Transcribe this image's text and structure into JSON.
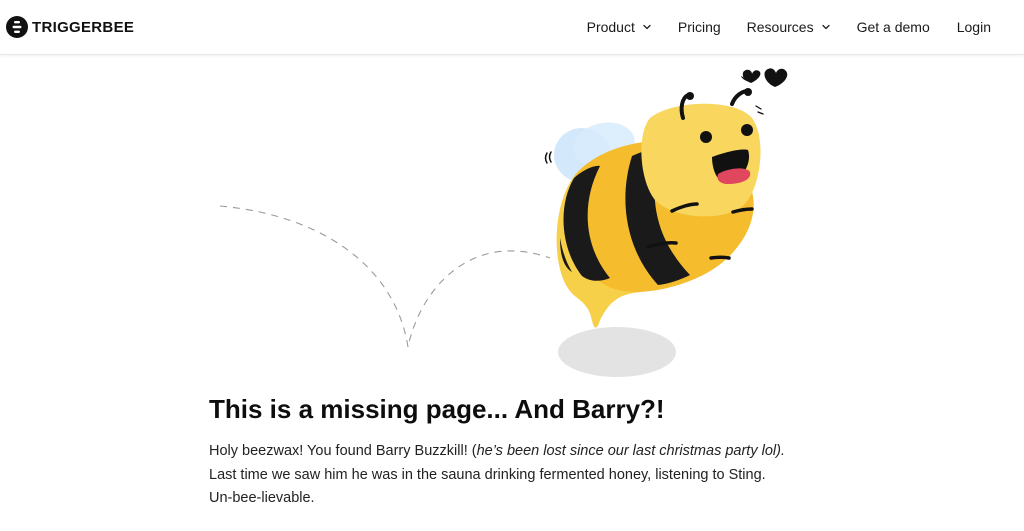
{
  "header": {
    "brand": "TRIGGERBEE",
    "nav": [
      {
        "label": "Product",
        "has_dropdown": true
      },
      {
        "label": "Pricing",
        "has_dropdown": false
      },
      {
        "label": "Resources",
        "has_dropdown": true
      },
      {
        "label": "Get a demo",
        "has_dropdown": false
      },
      {
        "label": "Login",
        "has_dropdown": false
      }
    ]
  },
  "main": {
    "title": "This is a missing page... And Barry?!",
    "body_intro": "Holy beezwax! You found Barry Buzzkill! (",
    "body_italic": "he’s been lost since our last christmas party lol).",
    "body_rest": " Last time we saw him he was in the sauna drinking fermented honey, listening to Sting. Un-bee-lievable."
  },
  "colors": {
    "bee_yellow": "#f7c02f",
    "bee_dark": "#1a1a1a",
    "wing_blue": "#cfe6fb",
    "shadow_gray": "#e3e3e3",
    "tongue_red": "#e0465d"
  },
  "icons": {
    "logo": "triggerbee-logo-icon",
    "dropdown": "chevron-down-icon",
    "bee": "bee-illustration",
    "hearts": "heart-icon"
  }
}
